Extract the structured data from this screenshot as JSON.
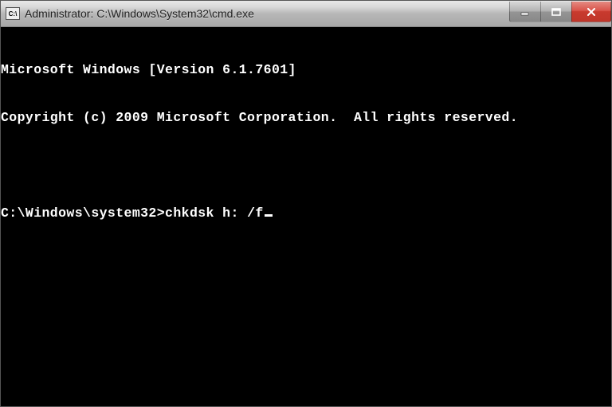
{
  "window": {
    "icon_label": "C:\\",
    "title": "Administrator: C:\\Windows\\System32\\cmd.exe"
  },
  "controls": {
    "minimize": "minimize",
    "maximize": "maximize",
    "close": "close"
  },
  "terminal": {
    "line1": "Microsoft Windows [Version 6.1.7601]",
    "line2": "Copyright (c) 2009 Microsoft Corporation.  All rights reserved.",
    "blank1": "",
    "prompt": "C:\\Windows\\system32>",
    "command": "chkdsk h: /f"
  }
}
